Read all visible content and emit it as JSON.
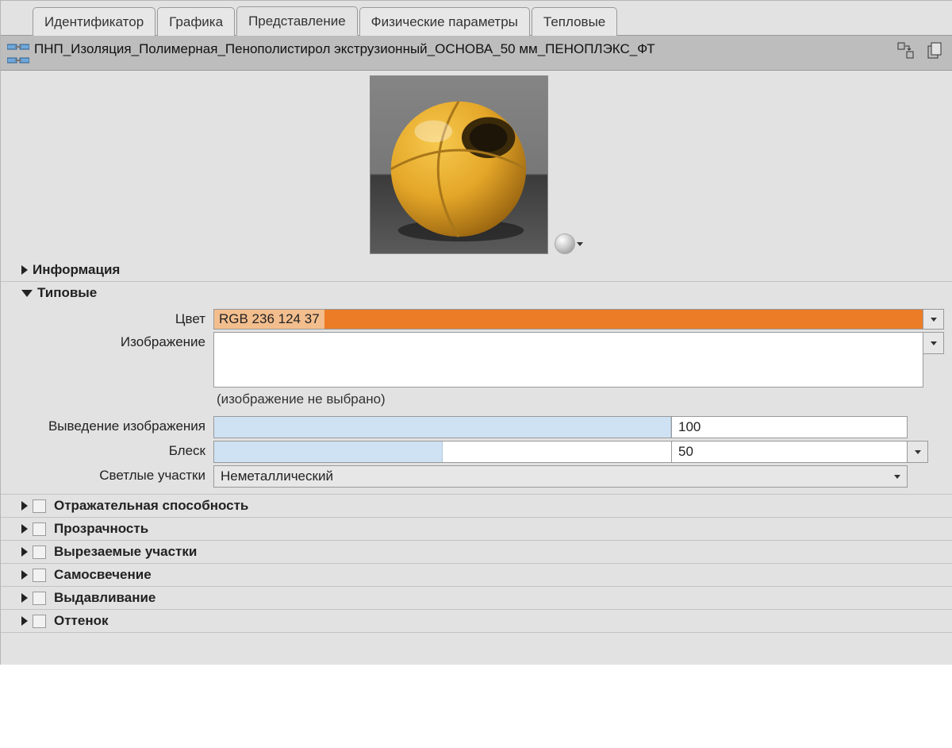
{
  "tabs": [
    {
      "label": "Идентификатор"
    },
    {
      "label": "Графика"
    },
    {
      "label": "Представление",
      "active": true
    },
    {
      "label": "Физические параметры"
    },
    {
      "label": "Тепловые"
    }
  ],
  "material_name": "ПНП_Изоляция_Полимерная_Пенополистирол экструзионный_ОСНОВА_50 мм_ПЕНОПЛЭКС_ФТ",
  "section_info": {
    "title": "Информация"
  },
  "section_generic": {
    "title": "Типовые",
    "color_label": "Цвет",
    "color_value": "RGB 236 124 37",
    "color_hex": "#ec7c25",
    "image_label": "Изображение",
    "image_hint": "(изображение не выбрано)",
    "fade_label": "Выведение изображения",
    "fade_value": "100",
    "fade_percent": 100,
    "gloss_label": "Блеск",
    "gloss_value": "50",
    "gloss_percent": 50,
    "highlights_label": "Светлые участки",
    "highlights_value": "Неметаллический"
  },
  "closed_sections": [
    {
      "title": "Отражательная способность",
      "checkbox": true
    },
    {
      "title": "Прозрачность",
      "checkbox": true
    },
    {
      "title": "Вырезаемые участки",
      "checkbox": true
    },
    {
      "title": "Самосвечение",
      "checkbox": true
    },
    {
      "title": "Выдавливание",
      "checkbox": true
    },
    {
      "title": "Оттенок",
      "checkbox": true
    }
  ]
}
